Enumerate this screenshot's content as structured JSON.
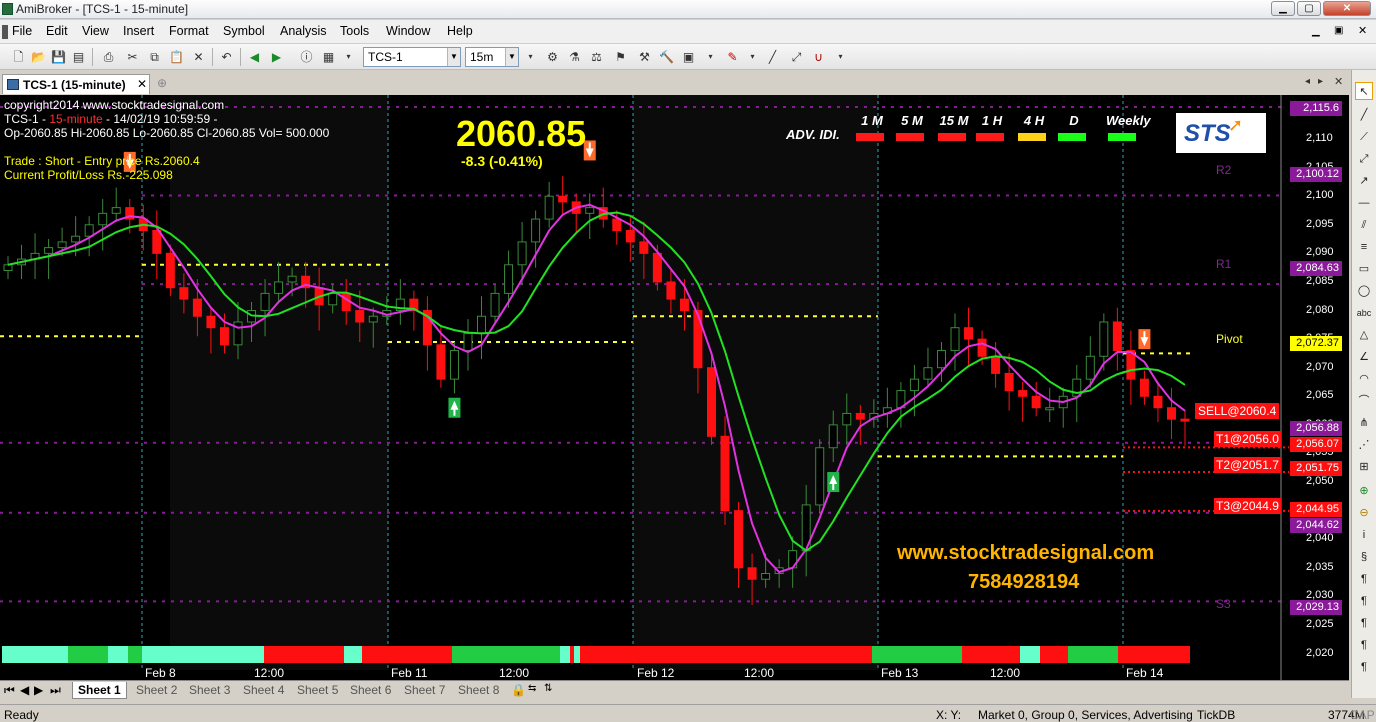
{
  "window": {
    "title": "AmiBroker - [TCS-1 - 15-minute]"
  },
  "menu": [
    "File",
    "Edit",
    "View",
    "Insert",
    "Format",
    "Symbol",
    "Analysis",
    "Tools",
    "Window",
    "Help"
  ],
  "toolbar": {
    "symbol": "TCS-1",
    "interval": "15m"
  },
  "tab": {
    "label": "TCS-1 (15-minute)"
  },
  "header": {
    "copyright": "copyright2014 www.stocktradesignal.com",
    "line1_symbol": "TCS-1 - ",
    "line1_interval": "15-minute",
    "line1_rest": " - 14/02/19 10:59:59 -",
    "ohlc": "Op-2060.85  Hi-2060.85  Lo-2060.85  Cl-2060.85  Vol=  500.000",
    "trade": "Trade : Short - Entry price Rs.2060.4",
    "pl": "Current Profit/Loss Rs.-225.098"
  },
  "price": {
    "value": "2060.85",
    "change": "-8.3 (-0.41%)"
  },
  "advidi": {
    "label": "ADV. IDI.",
    "frames": [
      "1 M",
      "5 M",
      "15 M",
      "1 H",
      "4 H",
      "D",
      "Weekly"
    ],
    "colors": [
      "#ff1a1a",
      "#ff1a1a",
      "#ff1a1a",
      "#ff1a1a",
      "#ffd21a",
      "#1aff1a",
      "#1aff1a"
    ]
  },
  "logo": "STS",
  "levels": {
    "r2": "R2",
    "r1": "R1",
    "pivot": "Pivot",
    "s3": "S3"
  },
  "signals": {
    "sell": "SELL@2060.4",
    "t1": "T1@2056.0",
    "t2": "T2@2051.7",
    "t3": "T3@2044.9"
  },
  "price_labels": [
    "2,115.6",
    "2,100.12",
    "2,084.63",
    "2,072.37",
    "2,056.88",
    "2,056.07",
    "2,051.75",
    "2,044.95",
    "2,044.62",
    "2,029.13"
  ],
  "y_ticks": [
    "2,110",
    "2,105",
    "2,100",
    "2,095",
    "2,090",
    "2,085",
    "2,080",
    "2,075",
    "2,070",
    "2,065",
    "2,060",
    "2,055",
    "2,050",
    "2,045",
    "2,040",
    "2,035",
    "2,030",
    "2,025",
    "2,020"
  ],
  "x_ticks": [
    "Feb 8",
    "12:00",
    "Feb 11",
    "12:00",
    "Feb 12",
    "12:00",
    "Feb 13",
    "12:00",
    "Feb 14"
  ],
  "website": "www.stocktradesignal.com",
  "phone": "7584928194",
  "sheets": [
    "Sheet 1",
    "Sheet 2",
    "Sheet 3",
    "Sheet 4",
    "Sheet 5",
    "Sheet 6",
    "Sheet 7",
    "Sheet 8"
  ],
  "status": {
    "ready": "Ready",
    "coords": "X:  Y:",
    "info": "Market 0, Group 0, Services, Advertising",
    "db": "TickDB",
    "mem": "3774M",
    "cap": "CAP"
  },
  "chart_data": {
    "type": "candlestick",
    "ylim": [
      2018,
      2117
    ],
    "last_close": 2060.85,
    "close_series": [
      2088,
      2089,
      2090,
      2091,
      2092,
      2093,
      2095,
      2097,
      2098,
      2096,
      2094,
      2090,
      2084,
      2082,
      2079,
      2077,
      2074,
      2078,
      2080,
      2083,
      2085,
      2086,
      2084,
      2081,
      2083,
      2080,
      2078,
      2079,
      2080,
      2082,
      2080,
      2074,
      2068,
      2073,
      2076,
      2079,
      2083,
      2088,
      2092,
      2096,
      2100,
      2099,
      2097,
      2098,
      2096,
      2094,
      2092,
      2090,
      2085,
      2082,
      2080,
      2070,
      2058,
      2045,
      2035,
      2033,
      2034,
      2035,
      2038,
      2046,
      2056,
      2060,
      2062,
      2061,
      2062,
      2063,
      2066,
      2068,
      2070,
      2073,
      2077,
      2075,
      2072,
      2069,
      2066,
      2065,
      2063,
      2063,
      2065,
      2068,
      2072,
      2078,
      2073,
      2068,
      2065,
      2063,
      2061,
      2060.85
    ],
    "sell_arrows_at": [
      9,
      43,
      84
    ],
    "buy_arrows_at": [
      33,
      61
    ]
  }
}
